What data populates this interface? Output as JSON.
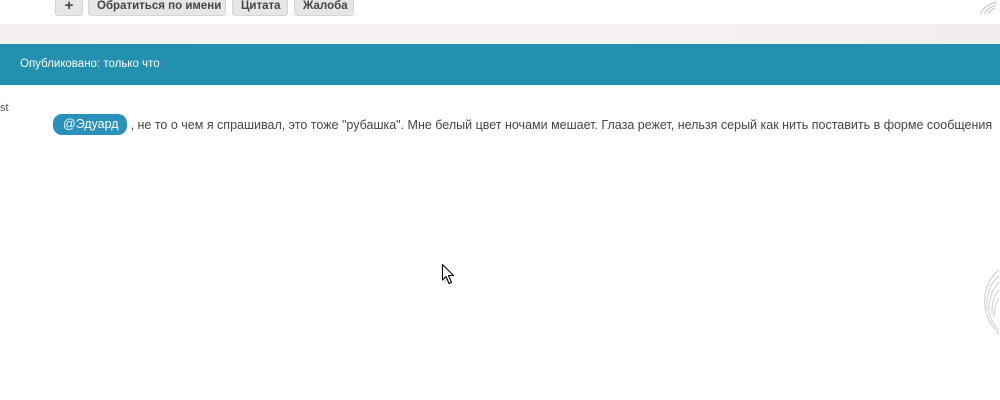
{
  "toolbar": {
    "plus_label": "+",
    "mention_label": "Обратиться по имени",
    "quote_label": "Цитата",
    "report_label": "Жалоба"
  },
  "post": {
    "published_label": "Опубликовано: только что",
    "author_fragment": "st",
    "mention": "@Эдуард",
    "text": ", не то о чем я спрашивал, это тоже \"рубашка\". Мне белый цвет ночами мешает. Глаза режет, нельзя серый как нить поставить в форме сообщения"
  },
  "colors": {
    "header_bg": "#2390b0",
    "mention_bg": "#2a91ba",
    "button_bg": "#e6e6e6"
  },
  "icons": {
    "top_right": "wing-icon",
    "cursor": "mouse-cursor-icon",
    "decoration": "wing-decoration-icon"
  }
}
